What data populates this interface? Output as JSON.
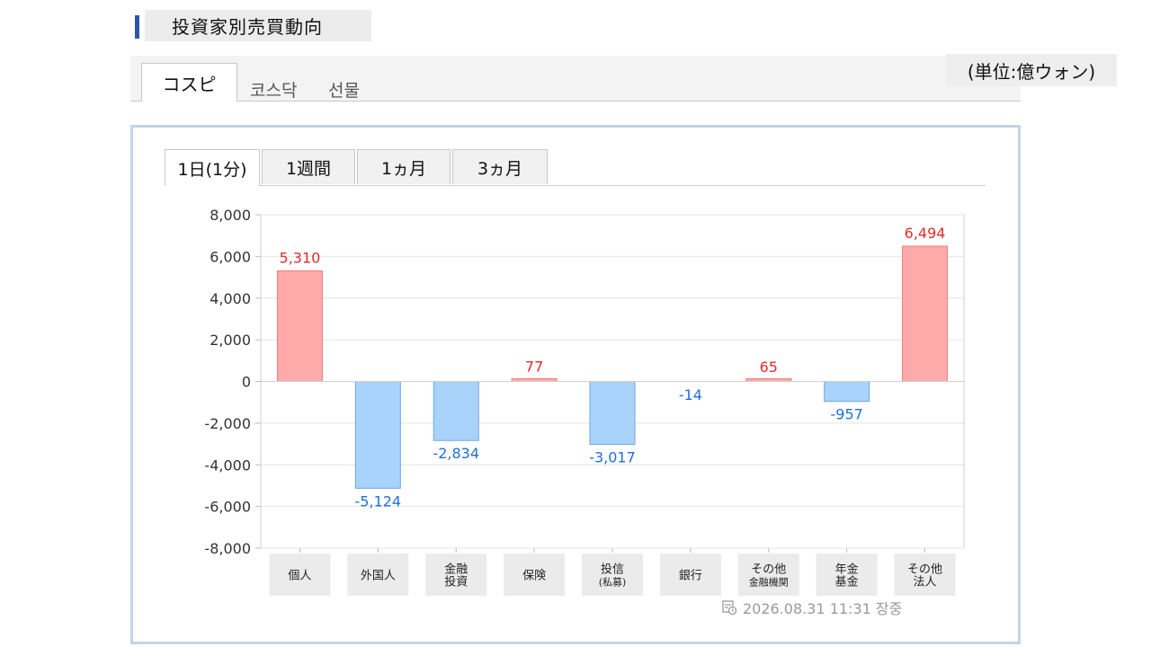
{
  "header": {
    "title": "投資家別売買動向"
  },
  "market_tabs": [
    "コスピ",
    "코스닥",
    "선물"
  ],
  "unit_label": "(単位:億ウォン)",
  "period_tabs": [
    "1日(1分)",
    "1週間",
    "1ヵ月",
    "3ヵ月"
  ],
  "timestamp": "2026.08.31 11:31 장중",
  "colors": {
    "positive_fill": "#ffaaaa",
    "positive_stroke": "#ee7d7d",
    "positive_text": "#e02b2b",
    "negative_fill": "#a9d3fb",
    "negative_stroke": "#6da6e3",
    "negative_text": "#1f6fd6",
    "accent": "#2f56a6"
  },
  "chart_data": {
    "type": "bar",
    "categories": [
      [
        "個人"
      ],
      [
        "外国人"
      ],
      [
        "金融",
        "投資"
      ],
      [
        "保険"
      ],
      [
        "投信",
        "(私募)"
      ],
      [
        "銀行"
      ],
      [
        "その他",
        "金融機関"
      ],
      [
        "年金",
        "基金"
      ],
      [
        "その他",
        "法人"
      ]
    ],
    "values": [
      5310,
      -5124,
      -2834,
      77,
      -3017,
      -14,
      65,
      -957,
      6494
    ],
    "value_labels": [
      "5,310",
      "-5,124",
      "-2,834",
      "77",
      "-3,017",
      "-14",
      "65",
      "-957",
      "6,494"
    ],
    "yticks": [
      "8,000",
      "6,000",
      "4,000",
      "2,000",
      "0",
      "-2,000",
      "-4,000",
      "-6,000",
      "-8,000"
    ],
    "ylim": [
      -8000,
      8000
    ],
    "grid": true
  }
}
